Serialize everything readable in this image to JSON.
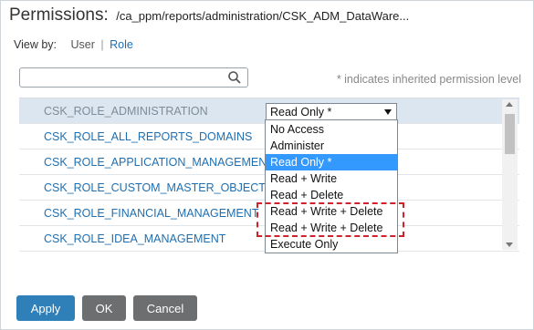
{
  "header": {
    "title": "Permissions:",
    "path": "/ca_ppm/reports/administration/CSK_ADM_DataWare..."
  },
  "view_by": {
    "label": "View by:",
    "user": "User",
    "separator": "|",
    "role": "Role"
  },
  "search": {
    "placeholder": ""
  },
  "hint": "* indicates inherited permission level",
  "rows": [
    {
      "label": "CSK_ROLE_ADMINISTRATION"
    },
    {
      "label": "CSK_ROLE_ALL_REPORTS_DOMAINS"
    },
    {
      "label": "CSK_ROLE_APPLICATION_MANAGEMENT"
    },
    {
      "label": "CSK_ROLE_CUSTOM_MASTER_OBJECTS"
    },
    {
      "label": "CSK_ROLE_FINANCIAL_MANAGEMENT"
    },
    {
      "label": "CSK_ROLE_IDEA_MANAGEMENT"
    }
  ],
  "select": {
    "value": "Read Only *"
  },
  "dropdown_options": [
    "No Access",
    "Administer",
    "Read Only *",
    "Read + Write",
    "Read + Delete",
    "Read + Write + Delete",
    "Read + Write + Delete",
    "Execute Only"
  ],
  "buttons": {
    "apply": "Apply",
    "ok": "OK",
    "cancel": "Cancel"
  },
  "colors": {
    "link": "#1f6fb0",
    "selected_option": "#3399ff",
    "apply_button": "#2f7fb9",
    "highlight": "#d0222b"
  }
}
